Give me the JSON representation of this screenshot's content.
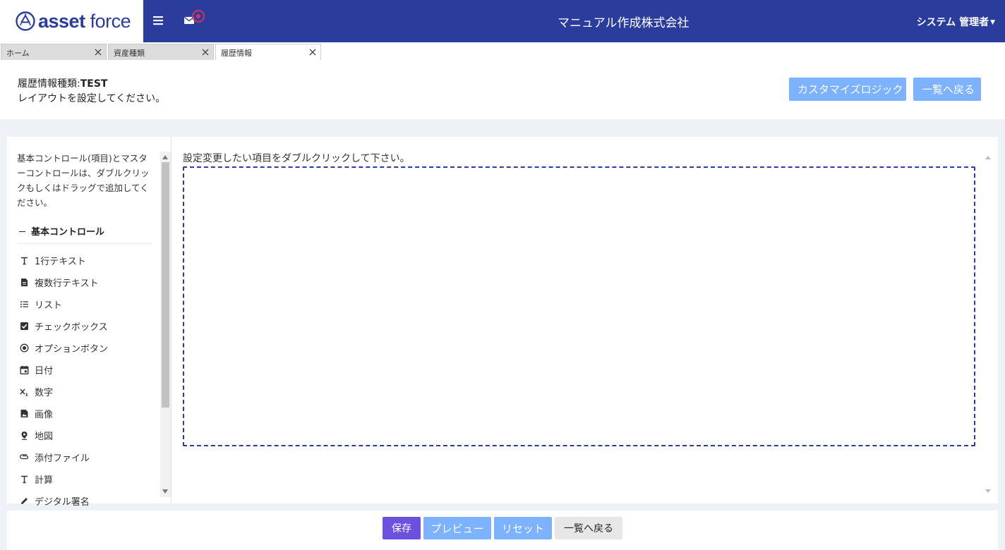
{
  "header": {
    "logo_bold": "asset",
    "logo_light": "force",
    "company": "マニュアル作成株式会社",
    "user": "システム 管理者",
    "colors": {
      "brand": "#2b3d9c",
      "notify": "#d6335a"
    }
  },
  "tabs": [
    {
      "label": "ホーム"
    },
    {
      "label": "資産種類"
    },
    {
      "label": "履歴情報"
    }
  ],
  "page": {
    "title_label": "履歴情報種類:",
    "title_value": "TEST",
    "subtitle": "レイアウトを設定してください。",
    "customize_logic": "カスタマイズロジック",
    "back_to_list": "一覧へ戻る"
  },
  "palette": {
    "help": "基本コントロール(項目)とマスターコントロールは、ダブルクリックもしくはドラッグで追加してください。",
    "section": "基本コントロール",
    "items": [
      {
        "label": "1行テキスト",
        "icon": "text-icon"
      },
      {
        "label": "複数行テキスト",
        "icon": "multiline-text-icon"
      },
      {
        "label": "リスト",
        "icon": "list-icon"
      },
      {
        "label": "チェックボックス",
        "icon": "checkbox-icon"
      },
      {
        "label": "オプションボタン",
        "icon": "radio-icon"
      },
      {
        "label": "日付",
        "icon": "calendar-icon"
      },
      {
        "label": "数字",
        "icon": "number-icon"
      },
      {
        "label": "画像",
        "icon": "image-icon"
      },
      {
        "label": "地図",
        "icon": "map-pin-icon"
      },
      {
        "label": "添付ファイル",
        "icon": "attachment-icon"
      },
      {
        "label": "計算",
        "icon": "calculation-icon"
      },
      {
        "label": "デジタル署名",
        "icon": "pen-icon"
      }
    ]
  },
  "canvas": {
    "hint": "設定変更したい項目をダブルクリックして下さい。"
  },
  "footer": {
    "save": "保存",
    "preview": "プレビュー",
    "reset": "リセット",
    "back": "一覧へ戻る",
    "colors": {
      "primary": "#6c50e0",
      "light": "#7cb2ff",
      "neutral": "#e7e7e7"
    }
  }
}
